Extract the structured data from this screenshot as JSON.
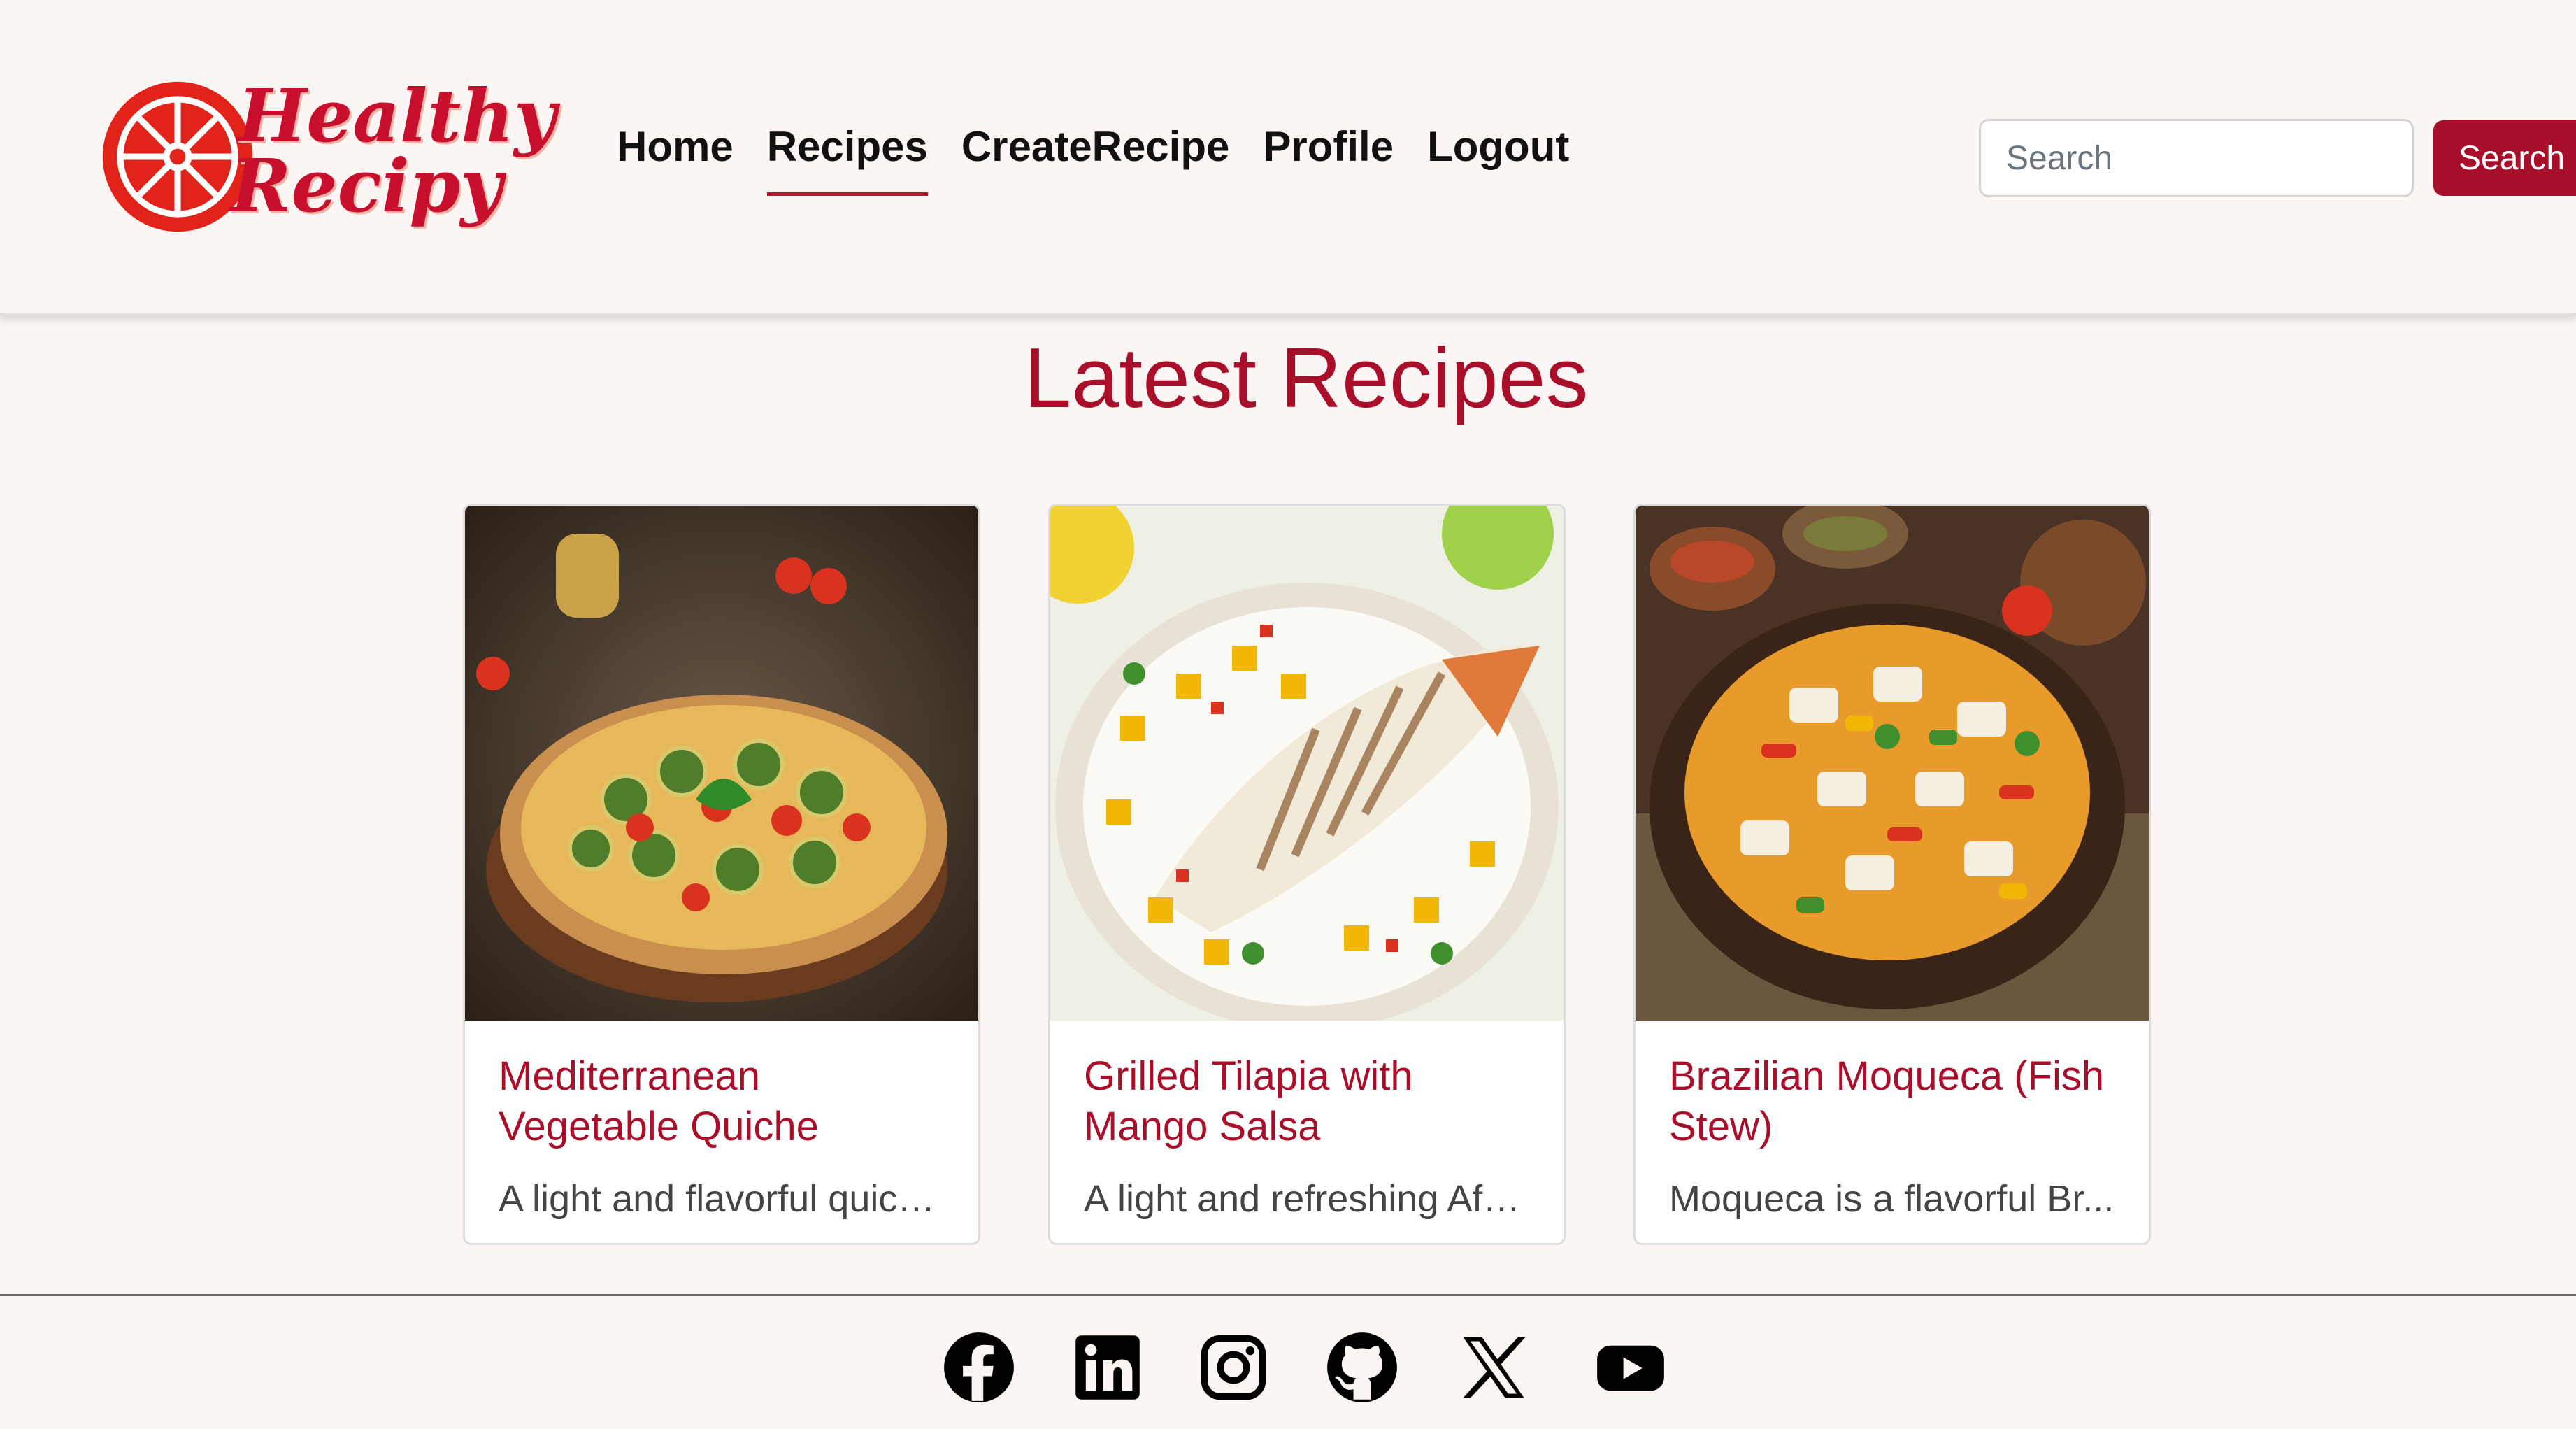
{
  "header": {
    "logo": {
      "line1": "Healthy",
      "line2": "Recipy"
    },
    "nav": [
      "Home",
      "Recipes",
      "CreateRecipe",
      "Profile",
      "Logout"
    ],
    "active_nav": "Recipes",
    "search": {
      "placeholder": "Search",
      "button_label": "Search"
    }
  },
  "main": {
    "title": "Latest Recipes",
    "recipes": [
      {
        "title": "Mediterranean Vegetable Quiche",
        "description": "A light and flavorful quich..."
      },
      {
        "title": "Grilled Tilapia with Mango Salsa",
        "description": "A light and refreshing Afri..."
      },
      {
        "title": "Brazilian Moqueca (Fish Stew)",
        "description": "Moqueca is a flavorful Br..."
      }
    ]
  },
  "footer": {
    "social_icons": [
      "facebook-icon",
      "linkedin-icon",
      "instagram-icon",
      "github-icon",
      "x-icon",
      "youtube-icon"
    ]
  },
  "colors": {
    "accent": "#a90f2a",
    "background": "#fbf6f4",
    "logo_red": "#c8102e"
  }
}
